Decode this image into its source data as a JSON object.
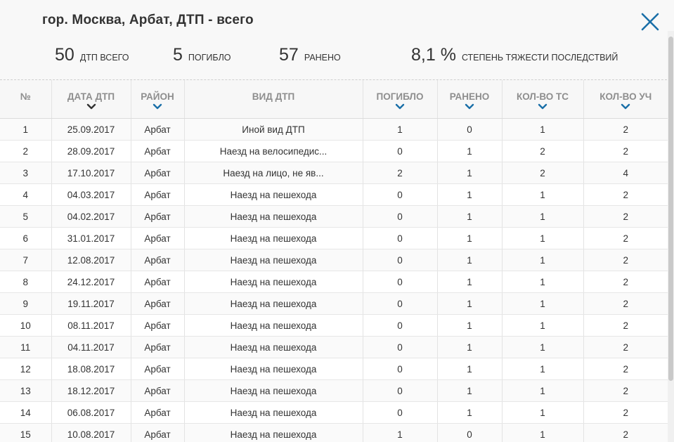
{
  "header": {
    "title": "гор. Москва, Арбат, ДТП - всего",
    "close_icon": "close-icon"
  },
  "stats": [
    {
      "value": "50",
      "label": "ДТП всего"
    },
    {
      "value": "5",
      "label": "погибло"
    },
    {
      "value": "57",
      "label": "ранено"
    },
    {
      "value": "8,1 %",
      "label": "степень тяжести последствий"
    }
  ],
  "table": {
    "columns": [
      {
        "label": "№",
        "sort": "none"
      },
      {
        "label": "Дата ДТП",
        "sort": "active"
      },
      {
        "label": "Район",
        "sort": "available"
      },
      {
        "label": "Вид ДТП",
        "sort": "none"
      },
      {
        "label": "Погибло",
        "sort": "available"
      },
      {
        "label": "Ранено",
        "sort": "available"
      },
      {
        "label": "Кол-во ТС",
        "sort": "available"
      },
      {
        "label": "Кол-во уч",
        "sort": "available"
      }
    ],
    "rows": [
      [
        "1",
        "25.09.2017",
        "Арбат",
        "Иной вид ДТП",
        "1",
        "0",
        "1",
        "2"
      ],
      [
        "2",
        "28.09.2017",
        "Арбат",
        "Наезд на велосипедис...",
        "0",
        "1",
        "2",
        "2"
      ],
      [
        "3",
        "17.10.2017",
        "Арбат",
        "Наезд на лицо, не яв...",
        "2",
        "1",
        "2",
        "4"
      ],
      [
        "4",
        "04.03.2017",
        "Арбат",
        "Наезд на пешехода",
        "0",
        "1",
        "1",
        "2"
      ],
      [
        "5",
        "04.02.2017",
        "Арбат",
        "Наезд на пешехода",
        "0",
        "1",
        "1",
        "2"
      ],
      [
        "6",
        "31.01.2017",
        "Арбат",
        "Наезд на пешехода",
        "0",
        "1",
        "1",
        "2"
      ],
      [
        "7",
        "12.08.2017",
        "Арбат",
        "Наезд на пешехода",
        "0",
        "1",
        "1",
        "2"
      ],
      [
        "8",
        "24.12.2017",
        "Арбат",
        "Наезд на пешехода",
        "0",
        "1",
        "1",
        "2"
      ],
      [
        "9",
        "19.11.2017",
        "Арбат",
        "Наезд на пешехода",
        "0",
        "1",
        "1",
        "2"
      ],
      [
        "10",
        "08.11.2017",
        "Арбат",
        "Наезд на пешехода",
        "0",
        "1",
        "1",
        "2"
      ],
      [
        "11",
        "04.11.2017",
        "Арбат",
        "Наезд на пешехода",
        "0",
        "1",
        "1",
        "2"
      ],
      [
        "12",
        "18.08.2017",
        "Арбат",
        "Наезд на пешехода",
        "0",
        "1",
        "1",
        "2"
      ],
      [
        "13",
        "18.12.2017",
        "Арбат",
        "Наезд на пешехода",
        "0",
        "1",
        "1",
        "2"
      ],
      [
        "14",
        "06.08.2017",
        "Арбат",
        "Наезд на пешехода",
        "0",
        "1",
        "1",
        "2"
      ],
      [
        "15",
        "10.08.2017",
        "Арбат",
        "Наезд на пешехода",
        "1",
        "0",
        "1",
        "2"
      ]
    ]
  },
  "colors": {
    "accent": "#1a6fa8",
    "active_sort": "#333333",
    "header_text": "#8e8e8e"
  }
}
